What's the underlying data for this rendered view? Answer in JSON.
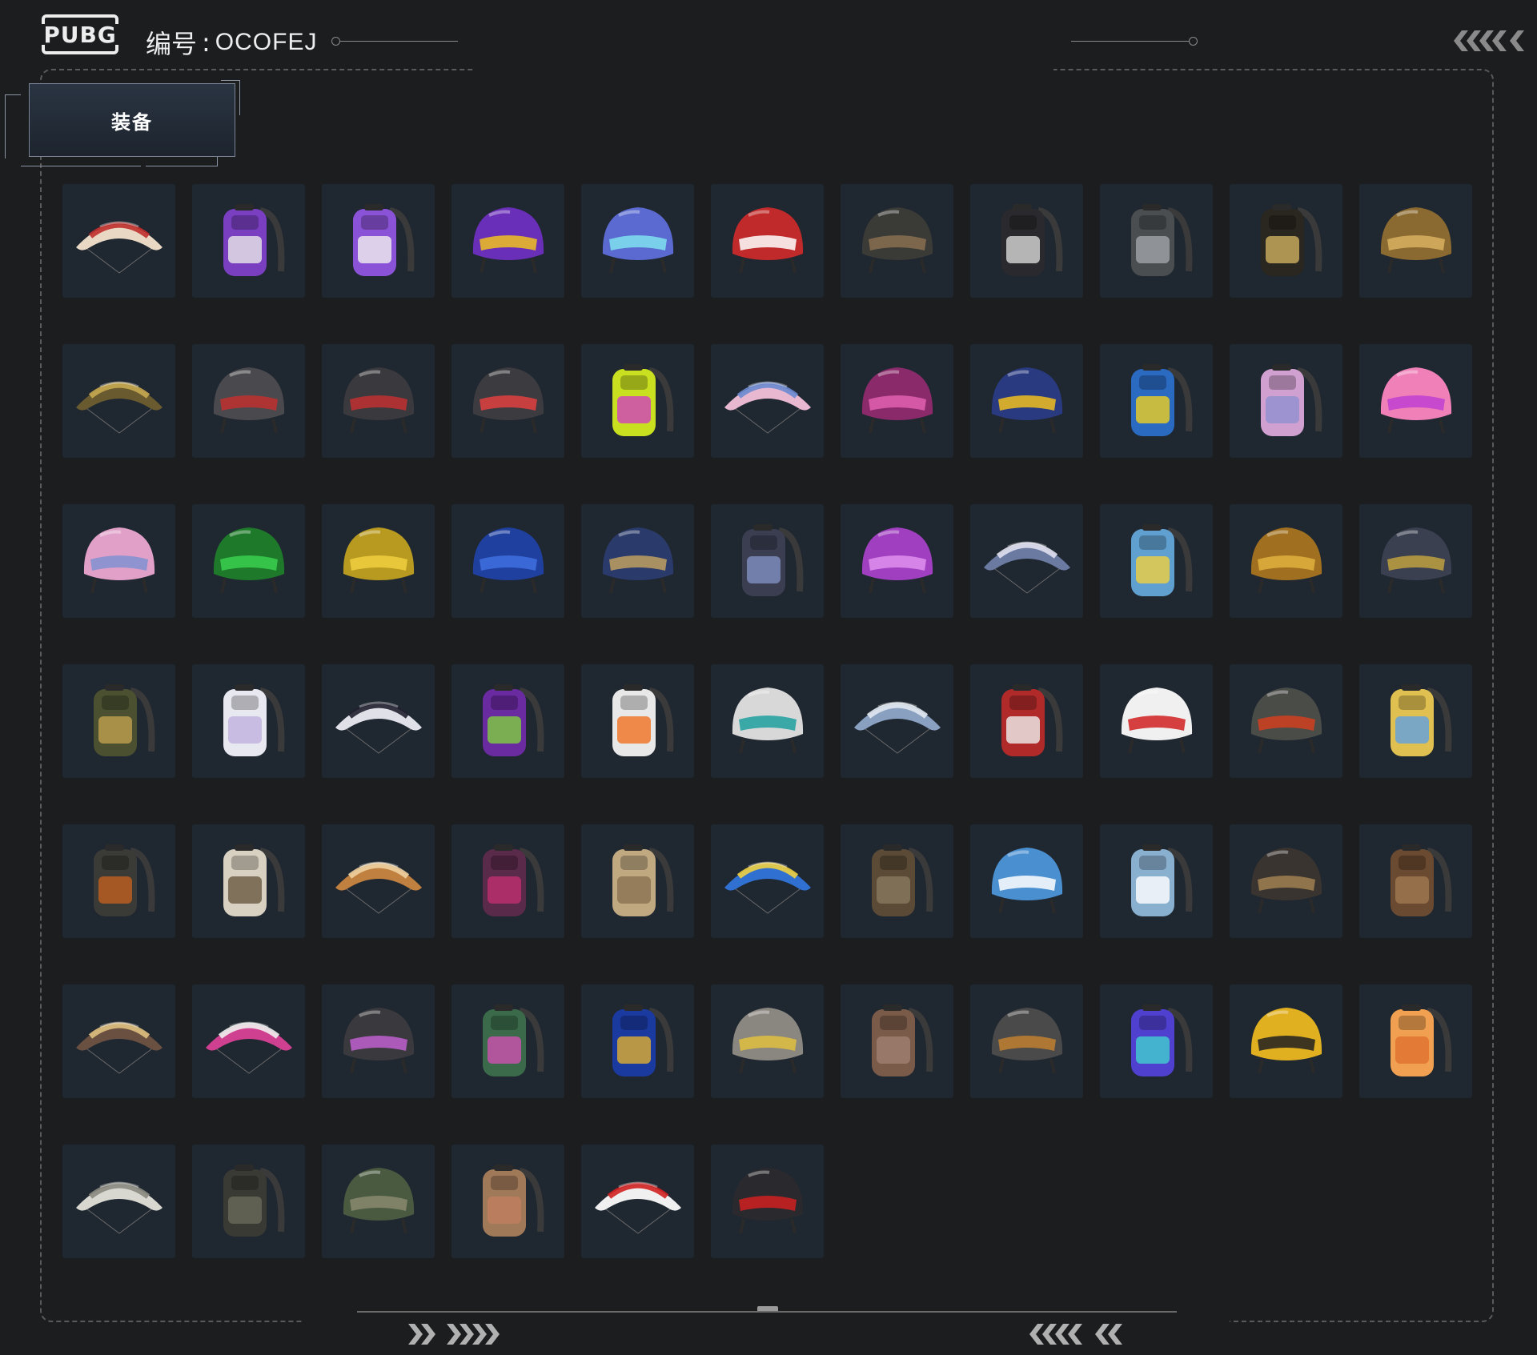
{
  "header": {
    "logo_text": "PUBG",
    "id_label": "编号",
    "id_separator": ":",
    "id_value": "OCOFEJ"
  },
  "tab": {
    "label": "装备"
  },
  "colors": {
    "background": "#1c1d1f",
    "cell": "#1f2731",
    "frame": "#5a5a5a",
    "tab_bg": "#2a3442"
  },
  "items": [
    {
      "type": "parachute",
      "primary": "#e8d8c4",
      "accent": "#c0302c"
    },
    {
      "type": "backpack",
      "primary": "#7a3fc0",
      "accent": "#e8e8e8"
    },
    {
      "type": "backpack",
      "primary": "#8a52d6",
      "accent": "#f0f0f0"
    },
    {
      "type": "helmet",
      "primary": "#6a2fb8",
      "accent": "#f0c020"
    },
    {
      "type": "helmet",
      "primary": "#5a6ad0",
      "accent": "#80e0f0"
    },
    {
      "type": "helmet",
      "primary": "#c02a2a",
      "accent": "#ffffff"
    },
    {
      "type": "helmet",
      "primary": "#3a3a36",
      "accent": "#8a7050"
    },
    {
      "type": "backpack",
      "primary": "#2a2a2e",
      "accent": "#d8d8d8"
    },
    {
      "type": "backpack",
      "primary": "#4a4e50",
      "accent": "#a0a4a8"
    },
    {
      "type": "backpack",
      "primary": "#2a2620",
      "accent": "#d0b060"
    },
    {
      "type": "helmet",
      "primary": "#8a6a30",
      "accent": "#d8b060"
    },
    {
      "type": "parachute",
      "primary": "#6a5a30",
      "accent": "#c8a850"
    },
    {
      "type": "helmet",
      "primary": "#4a4a4e",
      "accent": "#c03030"
    },
    {
      "type": "helmet",
      "primary": "#3a3a3e",
      "accent": "#c03030"
    },
    {
      "type": "helmet",
      "primary": "#3c3c40",
      "accent": "#e04040"
    },
    {
      "type": "backpack",
      "primary": "#c8e020",
      "accent": "#d040c0"
    },
    {
      "type": "parachute",
      "primary": "#e8b8d0",
      "accent": "#6a8ad0"
    },
    {
      "type": "helmet",
      "primary": "#8a2a6a",
      "accent": "#e060b0"
    },
    {
      "type": "helmet",
      "primary": "#2a3a80",
      "accent": "#f0c020"
    },
    {
      "type": "backpack",
      "primary": "#2a6ac0",
      "accent": "#f0d020"
    },
    {
      "type": "backpack",
      "primary": "#d0a0d0",
      "accent": "#9090d0"
    },
    {
      "type": "helmet",
      "primary": "#f080b8",
      "accent": "#c040d0"
    },
    {
      "type": "helmet",
      "primary": "#e0a0c8",
      "accent": "#8090d0"
    },
    {
      "type": "helmet",
      "primary": "#1e7a2a",
      "accent": "#3ad050"
    },
    {
      "type": "helmet",
      "primary": "#b89a20",
      "accent": "#f0d040"
    },
    {
      "type": "helmet",
      "primary": "#2040a0",
      "accent": "#4070e0"
    },
    {
      "type": "helmet",
      "primary": "#2a3a6a",
      "accent": "#c0a060"
    },
    {
      "type": "backpack",
      "primary": "#3a3e50",
      "accent": "#8090c0"
    },
    {
      "type": "helmet",
      "primary": "#a040c0",
      "accent": "#e090f0"
    },
    {
      "type": "parachute",
      "primary": "#6a7aa0",
      "accent": "#e0e0f0"
    },
    {
      "type": "backpack",
      "primary": "#60a0d0",
      "accent": "#f0d040"
    },
    {
      "type": "helmet",
      "primary": "#a07020",
      "accent": "#e0b040"
    },
    {
      "type": "helmet",
      "primary": "#3a4050",
      "accent": "#c0a040"
    },
    {
      "type": "backpack",
      "primary": "#4a5030",
      "accent": "#c0a050"
    },
    {
      "type": "backpack",
      "primary": "#e8e8f0",
      "accent": "#c0b0e0"
    },
    {
      "type": "parachute",
      "primary": "#e0e0e8",
      "accent": "#202030"
    },
    {
      "type": "backpack",
      "primary": "#6a2aa0",
      "accent": "#80d040"
    },
    {
      "type": "backpack",
      "primary": "#e8e8e8",
      "accent": "#f07020"
    },
    {
      "type": "helmet",
      "primary": "#d8d8d8",
      "accent": "#20a0a0"
    },
    {
      "type": "parachute",
      "primary": "#8aa0c0",
      "accent": "#e0e8f0"
    },
    {
      "type": "backpack",
      "primary": "#b02a2a",
      "accent": "#f0f0f0"
    },
    {
      "type": "helmet",
      "primary": "#f0f0f0",
      "accent": "#d02020"
    },
    {
      "type": "helmet",
      "primary": "#4a4c48",
      "accent": "#d04020"
    },
    {
      "type": "backpack",
      "primary": "#e0c050",
      "accent": "#60a0e0"
    },
    {
      "type": "backpack",
      "primary": "#3a3a36",
      "accent": "#c06020"
    },
    {
      "type": "backpack",
      "primary": "#d8d0c0",
      "accent": "#6a5a40"
    },
    {
      "type": "parachute",
      "primary": "#c08040",
      "accent": "#f0d0a0"
    },
    {
      "type": "backpack",
      "primary": "#5a2a4a",
      "accent": "#c03070"
    },
    {
      "type": "backpack",
      "primary": "#c0a880",
      "accent": "#8a7050"
    },
    {
      "type": "parachute",
      "primary": "#3070d0",
      "accent": "#f0d040"
    },
    {
      "type": "backpack",
      "primary": "#5a4a36",
      "accent": "#8a7860"
    },
    {
      "type": "helmet",
      "primary": "#4a90d0",
      "accent": "#ffffff"
    },
    {
      "type": "backpack",
      "primary": "#8ab0d0",
      "accent": "#ffffff"
    },
    {
      "type": "helmet",
      "primary": "#3a3430",
      "accent": "#a08050"
    },
    {
      "type": "backpack",
      "primary": "#6a4a30",
      "accent": "#a07850"
    },
    {
      "type": "parachute",
      "primary": "#6a5040",
      "accent": "#e0c080"
    },
    {
      "type": "parachute",
      "primary": "#d04090",
      "accent": "#f0f0f0"
    },
    {
      "type": "helmet",
      "primary": "#3a3a3e",
      "accent": "#c060d0"
    },
    {
      "type": "backpack",
      "primary": "#3a6a4a",
      "accent": "#d050b0"
    },
    {
      "type": "backpack",
      "primary": "#1a3aa0",
      "accent": "#e0b030"
    },
    {
      "type": "helmet",
      "primary": "#8a8680",
      "accent": "#e0c040"
    },
    {
      "type": "backpack",
      "primary": "#7a5a48",
      "accent": "#a08070"
    },
    {
      "type": "helmet",
      "primary": "#4a4a4a",
      "accent": "#c08030"
    },
    {
      "type": "backpack",
      "primary": "#5040d0",
      "accent": "#40d0d0"
    },
    {
      "type": "helmet",
      "primary": "#e0b020",
      "accent": "#202020"
    },
    {
      "type": "backpack",
      "primary": "#f0a050",
      "accent": "#e07030"
    },
    {
      "type": "parachute",
      "primary": "#d8d8d0",
      "accent": "#8a8a80"
    },
    {
      "type": "backpack",
      "primary": "#3a3a34",
      "accent": "#6a6a5a"
    },
    {
      "type": "helmet",
      "primary": "#4a5a40",
      "accent": "#8a8a70"
    },
    {
      "type": "backpack",
      "primary": "#a07a58",
      "accent": "#c08060"
    },
    {
      "type": "parachute",
      "primary": "#f0f0f0",
      "accent": "#d02020"
    },
    {
      "type": "helmet",
      "primary": "#2a2a2e",
      "accent": "#d02020"
    }
  ]
}
